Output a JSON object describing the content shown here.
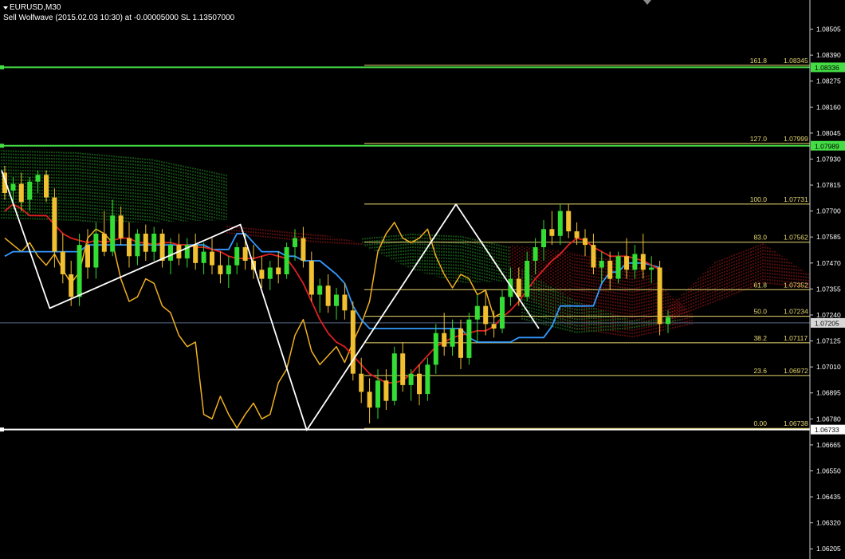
{
  "header": {
    "symbol": "EURUSD,M30",
    "signal": "Sell Wolfwave (2015.02.03 10:30) at -0.00005000 SL 1.13507000"
  },
  "colors": {
    "background": "#000000",
    "bull_candle": "#33dd33",
    "bear_candle": "#f0c030",
    "tenkan": "#e02020",
    "kijun": "#3399ff",
    "chikou": "#f0b020",
    "wolfwave": "#ffffff",
    "fib": "#e8d870",
    "green_level": "#44dd44",
    "kumo_bull": "#33cc33",
    "kumo_bear": "#dd2222"
  },
  "chart_data": {
    "type": "candlestick",
    "symbol": "EURUSD",
    "timeframe": "M30",
    "ylim": [
      1.0616,
      1.08634
    ],
    "y_tick_labels": [
      "1.08505",
      "1.08390",
      "1.08275",
      "1.08160",
      "1.08045",
      "1.07930",
      "1.07815",
      "1.07700",
      "1.07585",
      "1.07470",
      "1.07355",
      "1.07240",
      "1.07125",
      "1.07010",
      "1.06895",
      "1.06780",
      "1.06665",
      "1.06550",
      "1.06435",
      "1.06320",
      "1.06205"
    ],
    "price_tags": [
      {
        "label": "1.08336",
        "value": 1.08336,
        "color": "#44dd44",
        "text_color": "#000000"
      },
      {
        "label": "1.07989",
        "value": 1.07989,
        "color": "#44dd44",
        "text_color": "#000000"
      },
      {
        "label": "1.07205",
        "value": 1.07205,
        "color": "#d8d8d8",
        "text_color": "#000000"
      },
      {
        "label": "1.06733",
        "value": 1.06733,
        "color": "#ffffff",
        "text_color": "#000000"
      }
    ],
    "fibonacci": [
      {
        "level": "161.8",
        "price": "1.08345",
        "value": 1.08345
      },
      {
        "level": "127.0",
        "price": "1.07999",
        "value": 1.07999
      },
      {
        "level": "100.0",
        "price": "1.07731",
        "value": 1.07731
      },
      {
        "level": "83.0",
        "price": "1.07562",
        "value": 1.07562
      },
      {
        "level": "61.8",
        "price": "1.07352",
        "value": 1.07352
      },
      {
        "level": "50.0",
        "price": "1.07234",
        "value": 1.07234
      },
      {
        "level": "38.2",
        "price": "1.07117",
        "value": 1.07117
      },
      {
        "level": "23.6",
        "price": "1.06972",
        "value": 1.06972
      },
      {
        "level": "0.00",
        "price": "1.06738",
        "value": 1.06738
      }
    ],
    "candles": [
      [
        1.0787,
        1.079,
        1.0775,
        1.0778
      ],
      [
        1.0779,
        1.0785,
        1.0772,
        1.0782
      ],
      [
        1.0782,
        1.0787,
        1.077,
        1.0774
      ],
      [
        1.0775,
        1.0785,
        1.077,
        1.0783
      ],
      [
        1.0783,
        1.0788,
        1.0778,
        1.0786
      ],
      [
        1.0786,
        1.0788,
        1.0774,
        1.0776
      ],
      [
        1.0776,
        1.078,
        1.0745,
        1.0752
      ],
      [
        1.0752,
        1.076,
        1.0738,
        1.0742
      ],
      [
        1.0742,
        1.0748,
        1.0728,
        1.0732
      ],
      [
        1.0732,
        1.076,
        1.0728,
        1.0755
      ],
      [
        1.0755,
        1.0762,
        1.074,
        1.0745
      ],
      [
        1.0745,
        1.0765,
        1.074,
        1.076
      ],
      [
        1.076,
        1.077,
        1.075,
        1.0752
      ],
      [
        1.0752,
        1.0775,
        1.075,
        1.0768
      ],
      [
        1.0768,
        1.0772,
        1.0755,
        1.0758
      ],
      [
        1.0758,
        1.0765,
        1.0745,
        1.075
      ],
      [
        1.075,
        1.0762,
        1.0746,
        1.076
      ],
      [
        1.076,
        1.0764,
        1.0748,
        1.0752
      ],
      [
        1.0752,
        1.0763,
        1.0748,
        1.076
      ],
      [
        1.076,
        1.0762,
        1.0745,
        1.0748
      ],
      [
        1.0748,
        1.0758,
        1.0742,
        1.0755
      ],
      [
        1.0755,
        1.076,
        1.0746,
        1.0749
      ],
      [
        1.0749,
        1.0758,
        1.0745,
        1.0755
      ],
      [
        1.0755,
        1.076,
        1.0744,
        1.0747
      ],
      [
        1.0747,
        1.0756,
        1.0742,
        1.0752
      ],
      [
        1.0752,
        1.0758,
        1.0742,
        1.0746
      ],
      [
        1.0746,
        1.0752,
        1.0738,
        1.0742
      ],
      [
        1.0742,
        1.075,
        1.0736,
        1.0746
      ],
      [
        1.0746,
        1.0756,
        1.0742,
        1.0754
      ],
      [
        1.0754,
        1.076,
        1.0744,
        1.0748
      ],
      [
        1.0748,
        1.0755,
        1.074,
        1.0744
      ],
      [
        1.0744,
        1.075,
        1.0736,
        1.074
      ],
      [
        1.074,
        1.0748,
        1.0735,
        1.0745
      ],
      [
        1.0745,
        1.0752,
        1.0738,
        1.0742
      ],
      [
        1.0742,
        1.0756,
        1.074,
        1.0754
      ],
      [
        1.0754,
        1.0762,
        1.0748,
        1.0758
      ],
      [
        1.0758,
        1.0763,
        1.0745,
        1.0748
      ],
      [
        1.0748,
        1.0752,
        1.073,
        1.0733
      ],
      [
        1.0733,
        1.074,
        1.0725,
        1.0737
      ],
      [
        1.0737,
        1.0742,
        1.0725,
        1.0728
      ],
      [
        1.0728,
        1.0736,
        1.0722,
        1.0733
      ],
      [
        1.0733,
        1.0738,
        1.0722,
        1.0726
      ],
      [
        1.0726,
        1.073,
        1.0695,
        1.0698
      ],
      [
        1.0698,
        1.0705,
        1.0685,
        1.069
      ],
      [
        1.069,
        1.0696,
        1.0676,
        1.0683
      ],
      [
        1.0683,
        1.07,
        1.0678,
        1.0695
      ],
      [
        1.0695,
        1.07,
        1.0682,
        1.0686
      ],
      [
        1.0686,
        1.071,
        1.0684,
        1.0707
      ],
      [
        1.0707,
        1.0712,
        1.069,
        1.0693
      ],
      [
        1.0693,
        1.07,
        1.0686,
        1.0698
      ],
      [
        1.0698,
        1.0702,
        1.0684,
        1.0689
      ],
      [
        1.0689,
        1.0705,
        1.0686,
        1.0702
      ],
      [
        1.0702,
        1.072,
        1.0698,
        1.0716
      ],
      [
        1.0716,
        1.0725,
        1.0706,
        1.071
      ],
      [
        1.071,
        1.0722,
        1.0706,
        1.0718
      ],
      [
        1.0718,
        1.0722,
        1.07,
        1.0705
      ],
      [
        1.0705,
        1.0725,
        1.0702,
        1.0722
      ],
      [
        1.0722,
        1.0733,
        1.0712,
        1.0728
      ],
      [
        1.0728,
        1.0735,
        1.0715,
        1.072
      ],
      [
        1.072,
        1.0726,
        1.0714,
        1.0718
      ],
      [
        1.0718,
        1.0735,
        1.0716,
        1.0732
      ],
      [
        1.0732,
        1.0745,
        1.0728,
        1.074
      ],
      [
        1.074,
        1.0745,
        1.0728,
        1.0732
      ],
      [
        1.0732,
        1.0752,
        1.073,
        1.0748
      ],
      [
        1.0748,
        1.0758,
        1.0742,
        1.0754
      ],
      [
        1.0754,
        1.0766,
        1.0748,
        1.0762
      ],
      [
        1.0762,
        1.077,
        1.0755,
        1.0759
      ],
      [
        1.0759,
        1.0773,
        1.0755,
        1.077
      ],
      [
        1.077,
        1.0773,
        1.0758,
        1.0761
      ],
      [
        1.0761,
        1.0765,
        1.0755,
        1.0758
      ],
      [
        1.0758,
        1.0762,
        1.075,
        1.0755
      ],
      [
        1.0755,
        1.076,
        1.0742,
        1.0745
      ],
      [
        1.0745,
        1.0752,
        1.0738,
        1.0748
      ],
      [
        1.0748,
        1.0752,
        1.0735,
        1.074
      ],
      [
        1.074,
        1.0752,
        1.0738,
        1.075
      ],
      [
        1.075,
        1.0758,
        1.074,
        1.0744
      ],
      [
        1.0744,
        1.0755,
        1.074,
        1.0751
      ],
      [
        1.0751,
        1.076,
        1.074,
        1.0744
      ],
      [
        1.0744,
        1.075,
        1.0738,
        1.0745
      ],
      [
        1.0745,
        1.0748,
        1.0715,
        1.072
      ],
      [
        1.072,
        1.0726,
        1.0716,
        1.0723
      ]
    ],
    "series": [
      {
        "values": [
          1.077,
          1.0773,
          1.0771,
          1.0768,
          1.0768,
          1.0768,
          1.0764,
          1.076,
          1.0758,
          1.0757,
          1.0756,
          1.0757,
          1.0756,
          1.0757,
          1.0758,
          1.0758,
          1.0756,
          1.0756,
          1.0755,
          1.0756,
          1.0756,
          1.0755,
          1.0755,
          1.0754,
          1.0754,
          1.0753,
          1.0752,
          1.075,
          1.0749,
          1.0749,
          1.0749,
          1.075,
          1.0751,
          1.075,
          1.0749,
          1.0744,
          1.0738,
          1.073,
          1.0722,
          1.0716,
          1.0712,
          1.071,
          1.0706,
          1.0702,
          1.0698,
          1.0696,
          1.0694,
          1.0694,
          1.0695,
          1.0698,
          1.0702,
          1.0706,
          1.071,
          1.0712,
          1.0714,
          1.0715,
          1.0716,
          1.0717,
          1.0717,
          1.0719,
          1.0723,
          1.0726,
          1.073,
          1.0735,
          1.074,
          1.0744,
          1.0748,
          1.0751,
          1.0755,
          1.0758,
          1.0757,
          1.0754,
          1.0752,
          1.075,
          1.075,
          1.075,
          1.0749,
          1.0748,
          1.0746,
          1.0744
        ]
      },
      {
        "values": [
          1.075,
          1.0752,
          1.0752,
          1.0752,
          1.0752,
          1.0752,
          1.0752,
          1.0752,
          1.0752,
          1.0752,
          1.0755,
          1.0755,
          1.0755,
          1.0755,
          1.0755,
          1.0755,
          1.0755,
          1.0755,
          1.0755,
          1.0755,
          1.0755,
          1.0755,
          1.0755,
          1.0755,
          1.0755,
          1.0753,
          1.0753,
          1.0753,
          1.076,
          1.076,
          1.0756,
          1.0752,
          1.0752,
          1.0752,
          1.075,
          1.075,
          1.0748,
          1.0748,
          1.0748,
          1.0745,
          1.0742,
          1.0738,
          1.0728,
          1.0722,
          1.0718,
          1.0718,
          1.0718,
          1.0718,
          1.0718,
          1.0718,
          1.0718,
          1.0718,
          1.0718,
          1.0718,
          1.0718,
          1.0718,
          1.0714,
          1.0712,
          1.0712,
          1.0712,
          1.0712,
          1.0712,
          1.0714,
          1.0714,
          1.0714,
          1.0714,
          1.0719,
          1.0728,
          1.0728,
          1.0728,
          1.0728,
          1.0728,
          1.0738,
          1.0743,
          1.0743,
          1.0747,
          1.0747,
          1.0747,
          1.0746,
          1.0745
        ]
      },
      {
        "values": [
          1.0758,
          1.0755,
          1.0752,
          1.0756,
          1.075,
          1.0746,
          1.0751,
          1.0744,
          1.0738,
          1.0743,
          1.0758,
          1.0762,
          1.076,
          1.0756,
          1.074,
          1.073,
          1.0732,
          1.074,
          1.0738,
          1.0728,
          1.0725,
          1.0715,
          1.071,
          1.0712,
          1.068,
          1.0678,
          1.0688,
          1.068,
          1.0674,
          1.068,
          1.0685,
          1.0678,
          1.068,
          1.0694,
          1.07,
          1.0715,
          1.0722,
          1.0708,
          1.0702,
          1.0706,
          1.071,
          1.0703,
          1.0712,
          1.072,
          1.073,
          1.0752,
          1.076,
          1.0765,
          1.0758,
          1.0756,
          1.0758,
          1.0762,
          1.075,
          1.0742,
          1.0736,
          1.0742,
          1.074,
          1.0733,
          1.0735,
          1.0723,
          1.0725
        ]
      },
      {
        "values": [
          1.07705,
          1.06733,
          1.07731,
          1.07185
        ]
      }
    ],
    "wolfwave_points": [
      [
        1.0788,
        0
      ],
      [
        1.0727,
        6
      ],
      [
        1.0764,
        29
      ],
      [
        1.0673,
        37
      ],
      [
        1.0773,
        55
      ],
      [
        1.0718,
        65
      ]
    ]
  }
}
